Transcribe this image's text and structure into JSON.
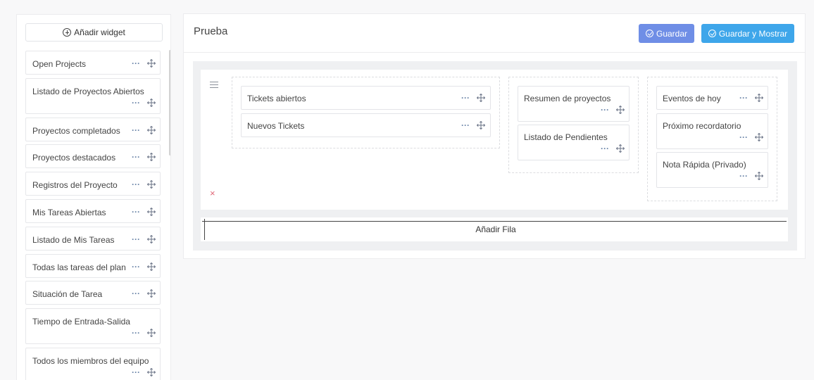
{
  "sidebar": {
    "add_widget_label": "Añadir widget",
    "widgets": [
      {
        "label": "Open Projects"
      },
      {
        "label": "Listado de Proyectos Abiertos"
      },
      {
        "label": "Proyectos completados"
      },
      {
        "label": "Proyectos destacados"
      },
      {
        "label": "Registros del Proyecto"
      },
      {
        "label": "Mis Tareas Abiertas"
      },
      {
        "label": "Listado de Mis Tareas"
      },
      {
        "label": "Todas las tareas del plan"
      },
      {
        "label": "Situación de Tarea"
      },
      {
        "label": "Tiempo de Entrada-Salida"
      },
      {
        "label": "Todos los miembros del equipo"
      }
    ]
  },
  "main": {
    "title": "Prueba",
    "save_label": "Guardar",
    "save_show_label": "Guardar y Mostrar",
    "add_row_label": "Añadir Fila",
    "remove_row_glyph": "×",
    "columns": [
      {
        "widgets": [
          {
            "label": "Tickets abiertos"
          },
          {
            "label": "Nuevos Tickets"
          }
        ]
      },
      {
        "widgets": [
          {
            "label": "Resumen de proyectos"
          },
          {
            "label": "Listado de Pendientes"
          }
        ]
      },
      {
        "widgets": [
          {
            "label": "Eventos de hoy"
          },
          {
            "label": "Próximo recordatorio"
          },
          {
            "label": "Nota Rápida (Privado)"
          }
        ]
      }
    ]
  },
  "icons": {
    "more": "more-dots-icon",
    "move": "move-arrows-icon",
    "add": "plus-circle-icon",
    "check": "check-circle-icon",
    "row_handle": "hamburger-icon",
    "close": "close-icon"
  },
  "colors": {
    "save": "#6f8ee6",
    "save_show": "#3ea6ea",
    "remove": "#e06777",
    "control": "#6a84a8"
  }
}
